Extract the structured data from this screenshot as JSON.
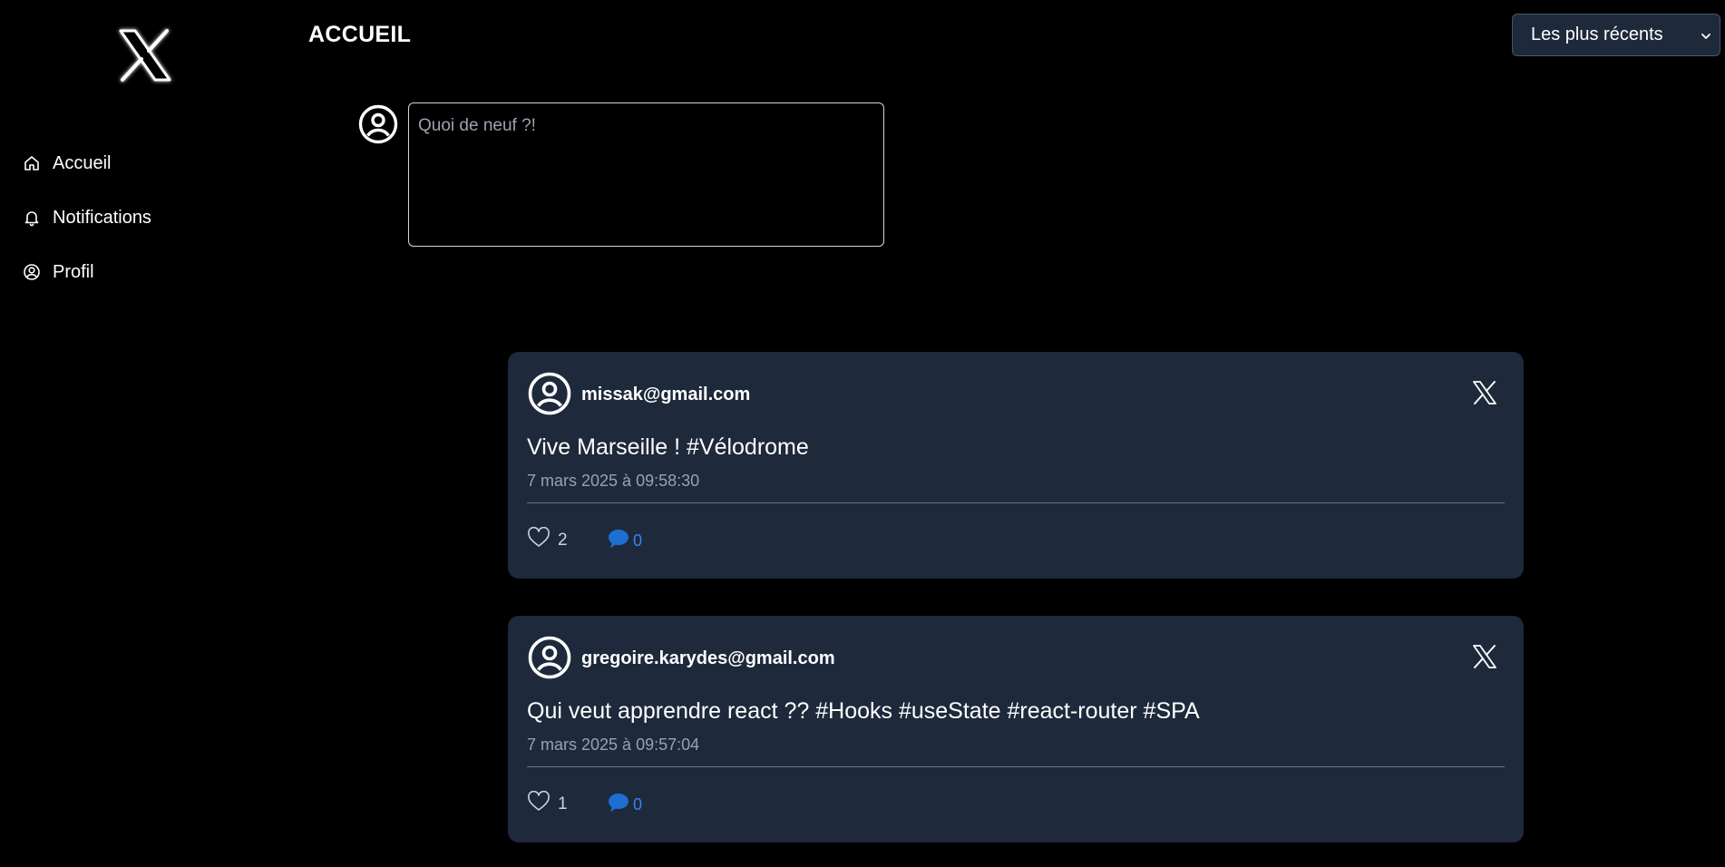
{
  "sidebar": {
    "logo_icon": "x-logo-icon",
    "items": [
      {
        "label": "Accueil",
        "icon": "home-icon"
      },
      {
        "label": "Notifications",
        "icon": "bell-icon"
      },
      {
        "label": "Profil",
        "icon": "user-circle-icon"
      }
    ]
  },
  "header": {
    "title": "ACCUEIL",
    "sort": {
      "selected": "Les plus récents",
      "icon": "chevron-down-icon"
    }
  },
  "composer": {
    "placeholder": "Quoi de neuf ?!",
    "value": "",
    "avatar_icon": "user-circle-icon"
  },
  "posts": [
    {
      "author": "missak@gmail.com",
      "content": "Vive Marseille ! #Vélodrome",
      "date": "7 mars 2025 à 09:58:30",
      "likes": "2",
      "comments": "0"
    },
    {
      "author": "gregoire.karydes@gmail.com",
      "content": "Qui veut apprendre react ?? #Hooks #useState #react-router #SPA",
      "date": "7 mars 2025 à 09:57:04",
      "likes": "1",
      "comments": "0"
    }
  ],
  "colors": {
    "background": "#000000",
    "card": "#1e293b",
    "accent": "#3b82f6",
    "muted": "#94a3b8"
  }
}
